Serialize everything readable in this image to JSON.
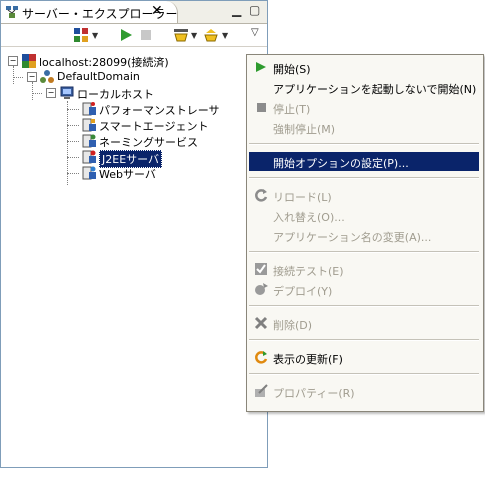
{
  "view": {
    "tab_title": "サーバー・エクスプローラー",
    "close_glyph": "✕",
    "minimize_glyph": "▭",
    "maximize_glyph": "▭"
  },
  "tree": {
    "root": "localhost:28099(接続済)",
    "domain": "DefaultDomain",
    "host": "ローカルホスト",
    "children": [
      "パフォーマンストレーサ",
      "スマートエージェント",
      "ネーミングサービス",
      "J2EEサーバ",
      "Webサーバ"
    ]
  },
  "menu": {
    "items": [
      {
        "label": "開始(S)",
        "enabled": true,
        "icon": "play-icon"
      },
      {
        "label": "アプリケーションを起動しないで開始(N)",
        "enabled": true,
        "icon": ""
      },
      {
        "label": "停止(T)",
        "enabled": false,
        "icon": "stop-icon"
      },
      {
        "label": "強制停止(M)",
        "enabled": false,
        "icon": ""
      },
      {
        "label": "開始オプションの設定(P)...",
        "enabled": true,
        "highlighted": true,
        "icon": ""
      },
      {
        "label": "リロード(L)",
        "enabled": false,
        "icon": "reload-icon"
      },
      {
        "label": "入れ替え(O)...",
        "enabled": false,
        "icon": ""
      },
      {
        "label": "アプリケーション名の変更(A)...",
        "enabled": false,
        "icon": ""
      },
      {
        "label": "接続テスト(E)",
        "enabled": false,
        "icon": "connection-test-icon"
      },
      {
        "label": "デプロイ(Y)",
        "enabled": false,
        "icon": "deploy-icon"
      },
      {
        "label": "削除(D)",
        "enabled": false,
        "icon": "delete-icon"
      },
      {
        "label": "表示の更新(F)",
        "enabled": true,
        "icon": "refresh-icon"
      },
      {
        "label": "プロパティー(R)",
        "enabled": false,
        "icon": "properties-icon"
      }
    ]
  },
  "colors": {
    "selection": "#0a246a",
    "menu_bg": "#f9f8f3",
    "disabled_text": "#a09c8f"
  }
}
